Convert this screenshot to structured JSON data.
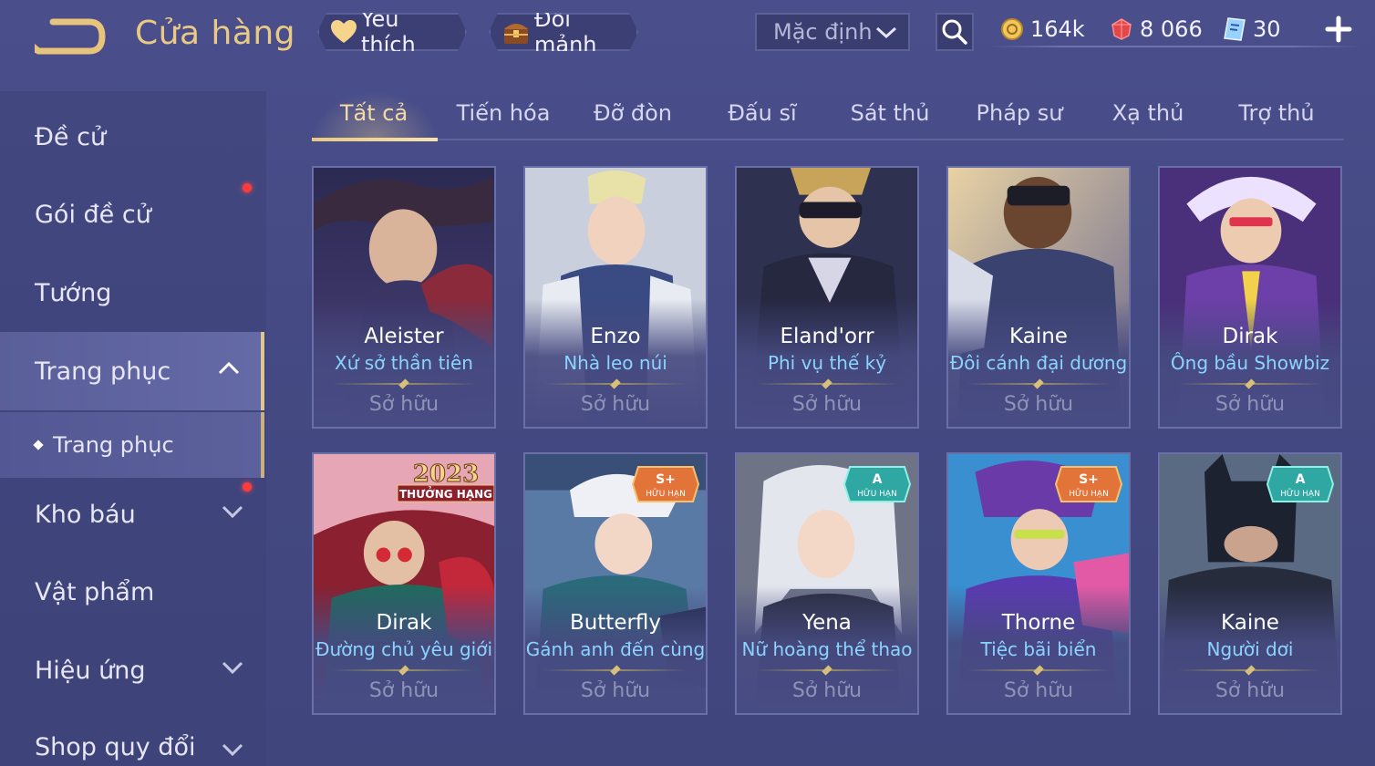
{
  "header": {
    "title": "Cửa hàng",
    "favorite_label": "Yêu thích",
    "exchange_label": "Đổi mảnh",
    "sort_value": "Mặc định",
    "currencies": {
      "gold": "164k",
      "gems": "8 066",
      "vouchers": "30"
    }
  },
  "sidebar": {
    "items": [
      {
        "label": "Đề cử"
      },
      {
        "label": "Gói đề cử"
      },
      {
        "label": "Tướng"
      },
      {
        "label": "Trang phục"
      },
      {
        "label": "Trang phục"
      },
      {
        "label": "Kho báu"
      },
      {
        "label": "Vật phẩm"
      },
      {
        "label": "Hiệu ứng"
      },
      {
        "label": "Shop quy đổi"
      }
    ]
  },
  "tabs": [
    "Tất cả",
    "Tiến hóa",
    "Đỡ đòn",
    "Đấu sĩ",
    "Sát thủ",
    "Pháp sư",
    "Xạ thủ",
    "Trợ thủ"
  ],
  "cards": [
    {
      "hero": "Aleister",
      "skin": "Xứ sở thần tiên",
      "status": "Sở hữu"
    },
    {
      "hero": "Enzo",
      "skin": "Nhà leo núi",
      "status": "Sở hữu"
    },
    {
      "hero": "Eland'orr",
      "skin": "Phi vụ thế kỷ",
      "status": "Sở hữu"
    },
    {
      "hero": "Kaine",
      "skin": "Đôi cánh đại dương",
      "status": "Sở hữu"
    },
    {
      "hero": "Dirak",
      "skin": "Ông bầu Showbiz",
      "status": "Sở hữu"
    },
    {
      "hero": "Dirak",
      "skin": "Đường chủ yêu giới",
      "status": "Sở hữu",
      "badge_top": "2023",
      "badge_bottom": "THƯỞNG HẠNG"
    },
    {
      "hero": "Butterfly",
      "skin": "Gánh anh đến cùng",
      "status": "Sở hữu",
      "badge_top": "S+",
      "badge_bottom": "HỮU HẠN"
    },
    {
      "hero": "Yena",
      "skin": "Nữ hoàng thể thao",
      "status": "Sở hữu",
      "badge_top": "A",
      "badge_bottom": "HỮU HẠN"
    },
    {
      "hero": "Thorne",
      "skin": "Tiệc bãi biển",
      "status": "Sở hữu",
      "badge_top": "S+",
      "badge_bottom": "HỮU HẠN"
    },
    {
      "hero": "Kaine",
      "skin": "Người dơi",
      "status": "Sở hữu",
      "badge_top": "A",
      "badge_bottom": "HỮU HẠN"
    }
  ],
  "colors": {
    "accent_gold": "#e9c983",
    "skin_name_blue": "#8ad4ff",
    "notification_red": "#ff3b3b",
    "badge_splus": "#e2743a",
    "badge_a": "#2fa8a4"
  }
}
